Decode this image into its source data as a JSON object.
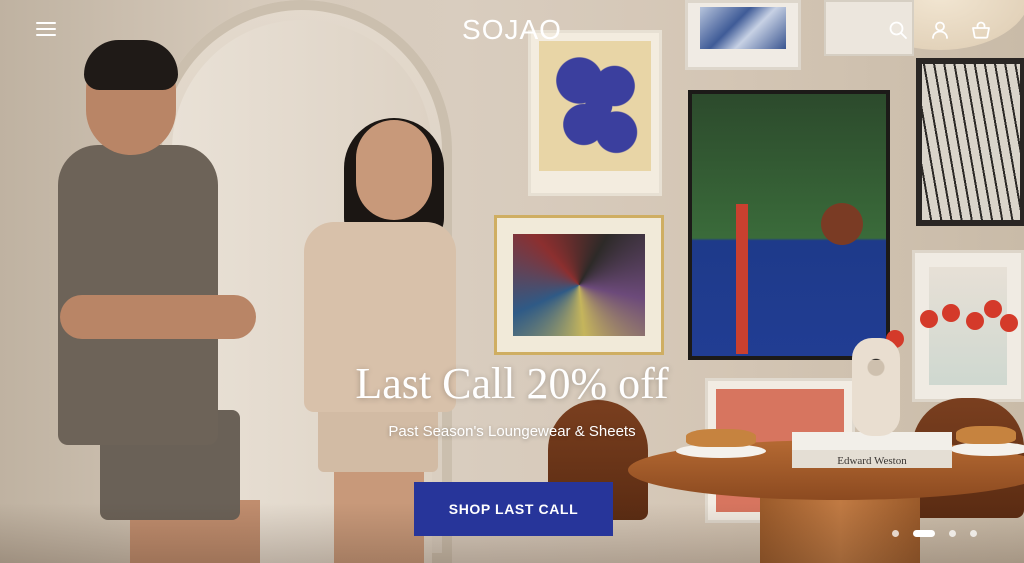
{
  "header": {
    "logo": "SOJAO",
    "menu_icon": "hamburger-menu-icon",
    "search_icon": "search-icon",
    "account_icon": "account-icon",
    "cart_icon": "shopping-basket-icon"
  },
  "hero": {
    "title": "Last Call 20% off",
    "subtitle": "Past Season's Loungewear & Sheets",
    "cta_label": "SHOP LAST CALL",
    "cta_color": "#27359a",
    "book_title": "Edward Weston"
  },
  "slider": {
    "slide_count": 4,
    "active_index": 1
  }
}
